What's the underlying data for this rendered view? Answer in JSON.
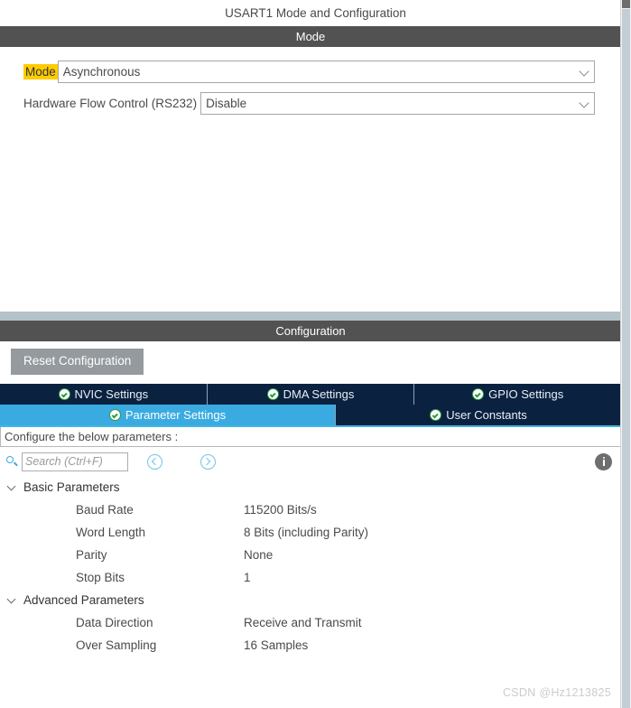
{
  "window": {
    "title": "USART1 Mode and Configuration"
  },
  "mode_section": {
    "header": "Mode",
    "fields": [
      {
        "label": "Mode",
        "value": "Asynchronous",
        "highlighted": true,
        "icon": "chevron-down-icon"
      },
      {
        "label": "Hardware Flow Control (RS232)",
        "value": "Disable",
        "highlighted": false,
        "icon": "chevron-down-icon"
      }
    ]
  },
  "config_section": {
    "header": "Configuration",
    "reset_button": "Reset Configuration",
    "tabs_row1": [
      {
        "label": "NVIC Settings",
        "icon": "check-circle-icon",
        "active": false
      },
      {
        "label": "DMA Settings",
        "icon": "check-circle-icon",
        "active": false
      },
      {
        "label": "GPIO Settings",
        "icon": "check-circle-icon",
        "active": false
      }
    ],
    "tabs_row2": [
      {
        "label": "Parameter Settings",
        "icon": "check-circle-icon",
        "active": true
      },
      {
        "label": "User Constants",
        "icon": "check-circle-icon",
        "active": false
      }
    ],
    "configure_label": "Configure the below parameters :",
    "toolbar": {
      "search_icon": "search-icon",
      "search_value": "",
      "search_placeholder": "Search (Ctrl+F)",
      "prev_icon": "chevron-left-circle-icon",
      "next_icon": "chevron-right-circle-icon",
      "info_icon": "info-circle-icon"
    },
    "groups": [
      {
        "name": "Basic Parameters",
        "expanded": true,
        "params": [
          {
            "name": "Baud Rate",
            "value": "115200 Bits/s"
          },
          {
            "name": "Word Length",
            "value": "8 Bits (including Parity)"
          },
          {
            "name": "Parity",
            "value": "None"
          },
          {
            "name": "Stop Bits",
            "value": "1"
          }
        ]
      },
      {
        "name": "Advanced Parameters",
        "expanded": true,
        "params": [
          {
            "name": "Data Direction",
            "value": "Receive and Transmit"
          },
          {
            "name": "Over Sampling",
            "value": "16 Samples"
          }
        ]
      }
    ]
  },
  "watermark": "CSDN @Hz1213825",
  "colors": {
    "section_header_bg": "#525252",
    "tab_inactive_bg": "#0a2240",
    "tab_active_bg": "#3aabe0",
    "highlight_yellow": "#ffcc00",
    "check_green": "#2f9b3f",
    "panel_divider": "#b4c2c9",
    "reset_button_bg": "#949a9e"
  }
}
